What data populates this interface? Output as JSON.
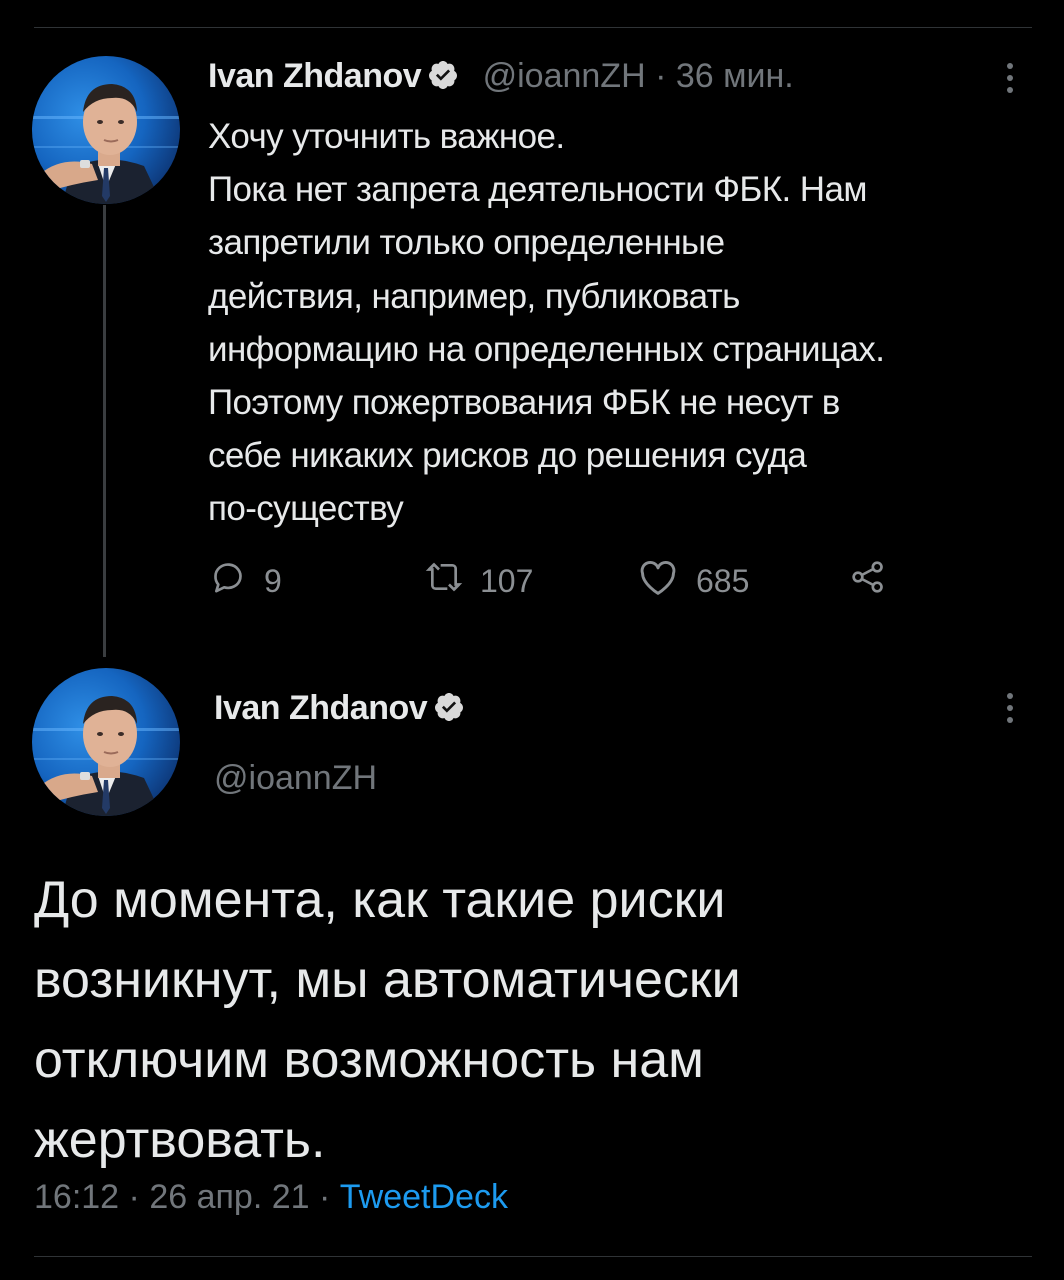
{
  "colors": {
    "background": "#000000",
    "text": "#e7e9ea",
    "muted": "#71767b",
    "link": "#1d9bf0",
    "verified": "#1d9bf0"
  },
  "tweet1": {
    "author_name": "Ivan Zhdanov",
    "handle": "@ioannZH",
    "separator": "·",
    "time_ago": "36 мин.",
    "lines": [
      "Хочу уточнить важное.",
      "Пока нет запрета деятельности ФБК. Нам",
      "запретили только определенные",
      "действия, например, публиковать",
      "информацию на определенных страницах.",
      "Поэтому пожертвования ФБК не несут в",
      "себе никаких рисков до решения суда",
      "по-существу"
    ],
    "actions": {
      "reply_count": "9",
      "retweet_count": "107",
      "like_count": "685"
    }
  },
  "tweet2": {
    "author_name": "Ivan Zhdanov",
    "handle": "@ioannZH",
    "lines": [
      "До момента, как такие риски",
      "возникнут, мы автоматически",
      "отключим возможность нам",
      "жертвовать."
    ],
    "time": "16:12",
    "separator": "·",
    "date": "26 апр. 21",
    "source": "TweetDeck"
  },
  "icons": [
    "verified-icon",
    "more-icon",
    "reply-icon",
    "retweet-icon",
    "like-icon",
    "share-icon"
  ]
}
